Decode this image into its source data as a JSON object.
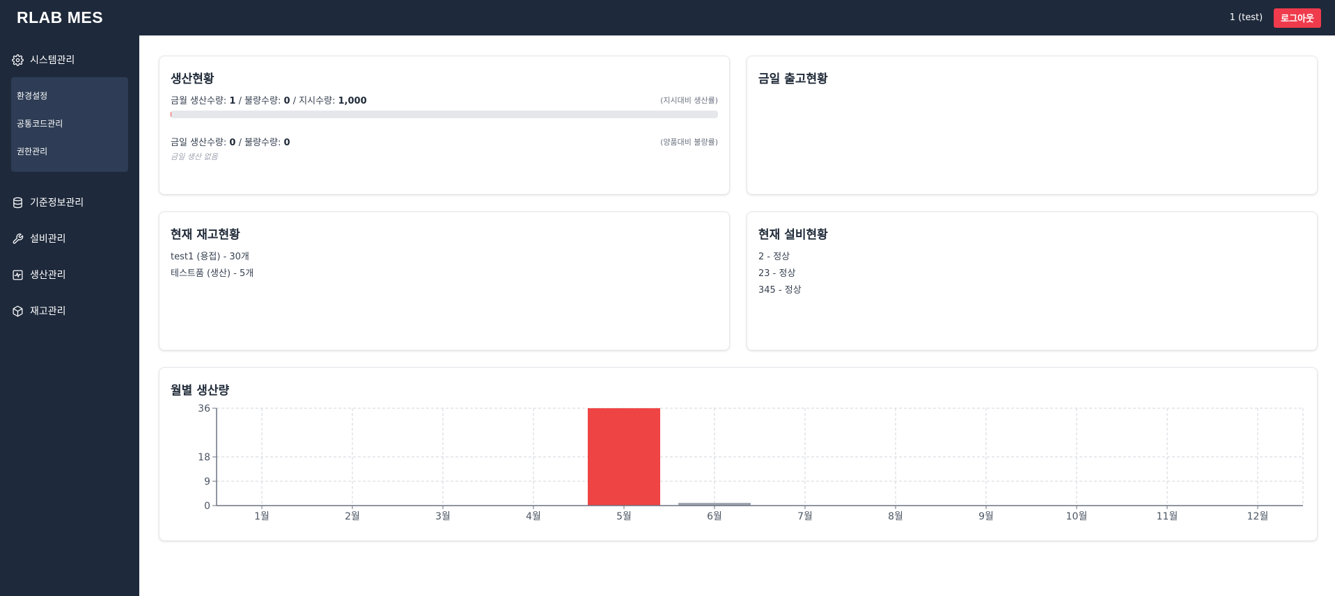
{
  "app": {
    "title": "RLAB MES",
    "user_label": "1 (test)",
    "logout_label": "로그아웃"
  },
  "sidebar": {
    "groups": [
      {
        "label": "시스템관리",
        "icon": "gear-icon"
      },
      {
        "label": "기준정보관리",
        "icon": "database-icon"
      },
      {
        "label": "설비관리",
        "icon": "wrench-icon"
      },
      {
        "label": "생산관리",
        "icon": "activity-icon"
      },
      {
        "label": "재고관리",
        "icon": "box-icon"
      }
    ],
    "system_submenu": [
      {
        "label": "환경설정"
      },
      {
        "label": "공통코드관리"
      },
      {
        "label": "권한관리"
      }
    ]
  },
  "production": {
    "title": "생산현황",
    "month_prefix": "금월 생산수량: ",
    "month_qty": "1",
    "bad_prefix": " / 불량수량: ",
    "month_bad": "0",
    "order_prefix": " / 지시수량: ",
    "month_order": "1,000",
    "month_hint": "(지시대비 생산률)",
    "month_progress": 0.001,
    "today_prefix": "금일 생산수량: ",
    "today_qty": "0",
    "today_bad_prefix": " / 불량수량: ",
    "today_bad": "0",
    "today_hint": "(양품대비 불량률)",
    "today_empty": "금일 생산 없음"
  },
  "shipment": {
    "title": "금일 출고현황"
  },
  "inventory": {
    "title": "현재 재고현황",
    "items": [
      "test1 (용접) - 30개",
      "테스트품 (생산) - 5개"
    ]
  },
  "equipment": {
    "title": "현재 설비현황",
    "items": [
      "2 - 정상",
      "23 - 정상",
      "345 - 정상"
    ]
  },
  "monthly": {
    "title": "월별 생산량"
  },
  "chart_data": {
    "type": "bar",
    "title": "월별 생산량",
    "categories": [
      "1월",
      "2월",
      "3월",
      "4월",
      "5월",
      "6월",
      "7월",
      "8월",
      "9월",
      "10월",
      "11월",
      "12월"
    ],
    "series": [
      {
        "values": [
          0,
          0,
          0,
          0,
          36,
          1,
          0,
          0,
          0,
          0,
          0,
          0
        ]
      }
    ],
    "bar_colors": {
      "highlight": "#ef4444",
      "normal": "#9ca3af"
    },
    "highlight_index": 4,
    "ylim": [
      0,
      36
    ],
    "yticks": [
      0,
      9,
      18,
      36
    ],
    "grid": true,
    "xlabel": "",
    "ylabel": ""
  }
}
